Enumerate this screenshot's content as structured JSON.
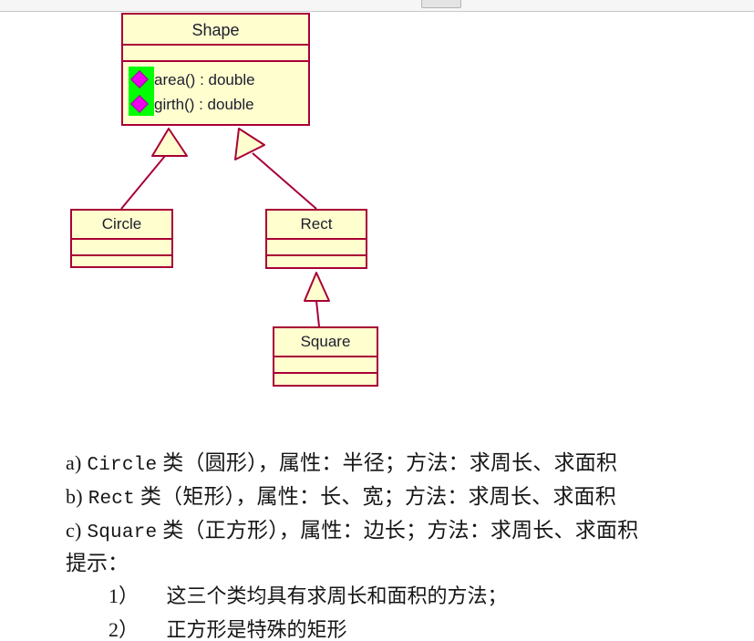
{
  "top_bar": {
    "button_label": ""
  },
  "diagram": {
    "title": "UML class diagram",
    "colors": {
      "border": "#A80036",
      "fill": "#FEFECE",
      "selection_highlight": "#00FF00",
      "visibility_marker": "#EE00EE",
      "text": "#1d1d2e"
    },
    "classes": [
      {
        "id": "shape",
        "name": "Shape",
        "attributes": [],
        "methods": [
          {
            "visibility": "public-diamond-icon",
            "signature": "area() : double",
            "highlighted": true
          },
          {
            "visibility": "public-diamond-icon",
            "signature": "girth() : double",
            "highlighted": true
          }
        ]
      },
      {
        "id": "circle",
        "name": "Circle",
        "attributes": [],
        "methods": []
      },
      {
        "id": "rect",
        "name": "Rect",
        "attributes": [],
        "methods": []
      },
      {
        "id": "square",
        "name": "Square",
        "attributes": [],
        "methods": []
      }
    ],
    "relations": [
      {
        "type": "generalization",
        "from": "Circle",
        "to": "Shape"
      },
      {
        "type": "generalization",
        "from": "Rect",
        "to": "Shape"
      },
      {
        "type": "generalization",
        "from": "Square",
        "to": "Rect"
      }
    ]
  },
  "text": {
    "items": [
      {
        "marker": "a)",
        "latin": "Circle",
        "rest": "类（圆形），属性：半径；方法：求周长、求面积"
      },
      {
        "marker": "b)",
        "latin": "Rect",
        "rest": "类（矩形），属性：长、宽；方法：求周长、求面积"
      },
      {
        "marker": "c)",
        "latin": "Square",
        "rest": "类（正方形），属性：边长；方法：求周长、求面积"
      }
    ],
    "hint_label": "提示：",
    "hints": [
      {
        "num": "1）",
        "body": "这三个类均具有求周长和面积的方法；"
      },
      {
        "num": "2）",
        "body": "正方形是特殊的矩形"
      }
    ]
  }
}
